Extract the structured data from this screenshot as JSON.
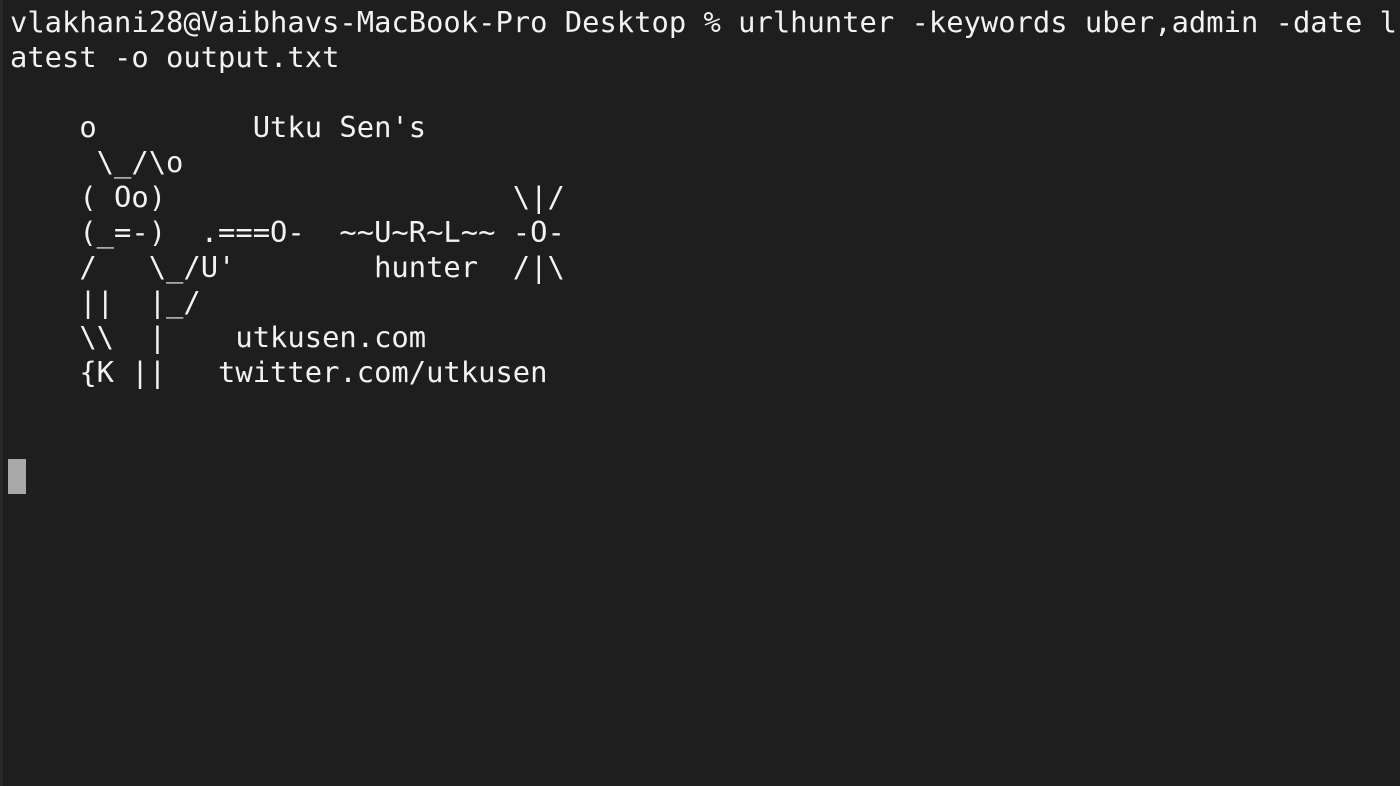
{
  "terminal": {
    "command_line_1": "vlakhani28@Vaibhavs-MacBook-Pro Desktop % urlhunter -keywords uber,admin -date l",
    "command_line_2": "atest -o output.txt",
    "banner": [
      "    o         Utku Sen's",
      "     \\_/\\o",
      "    ( Oo)                    \\|/",
      "    (_=-)  .===O-  ~~U~R~L~~ -O-",
      "    /   \\_/U'        hunter  /|\\",
      "    ||  |_/",
      "    \\\\  |    utkusen.com",
      "    {K ||   twitter.com/utkusen"
    ],
    "colors": {
      "background": "#1e1e1e",
      "text": "#f2f2f2",
      "cursor": "#a8a8a8"
    }
  }
}
